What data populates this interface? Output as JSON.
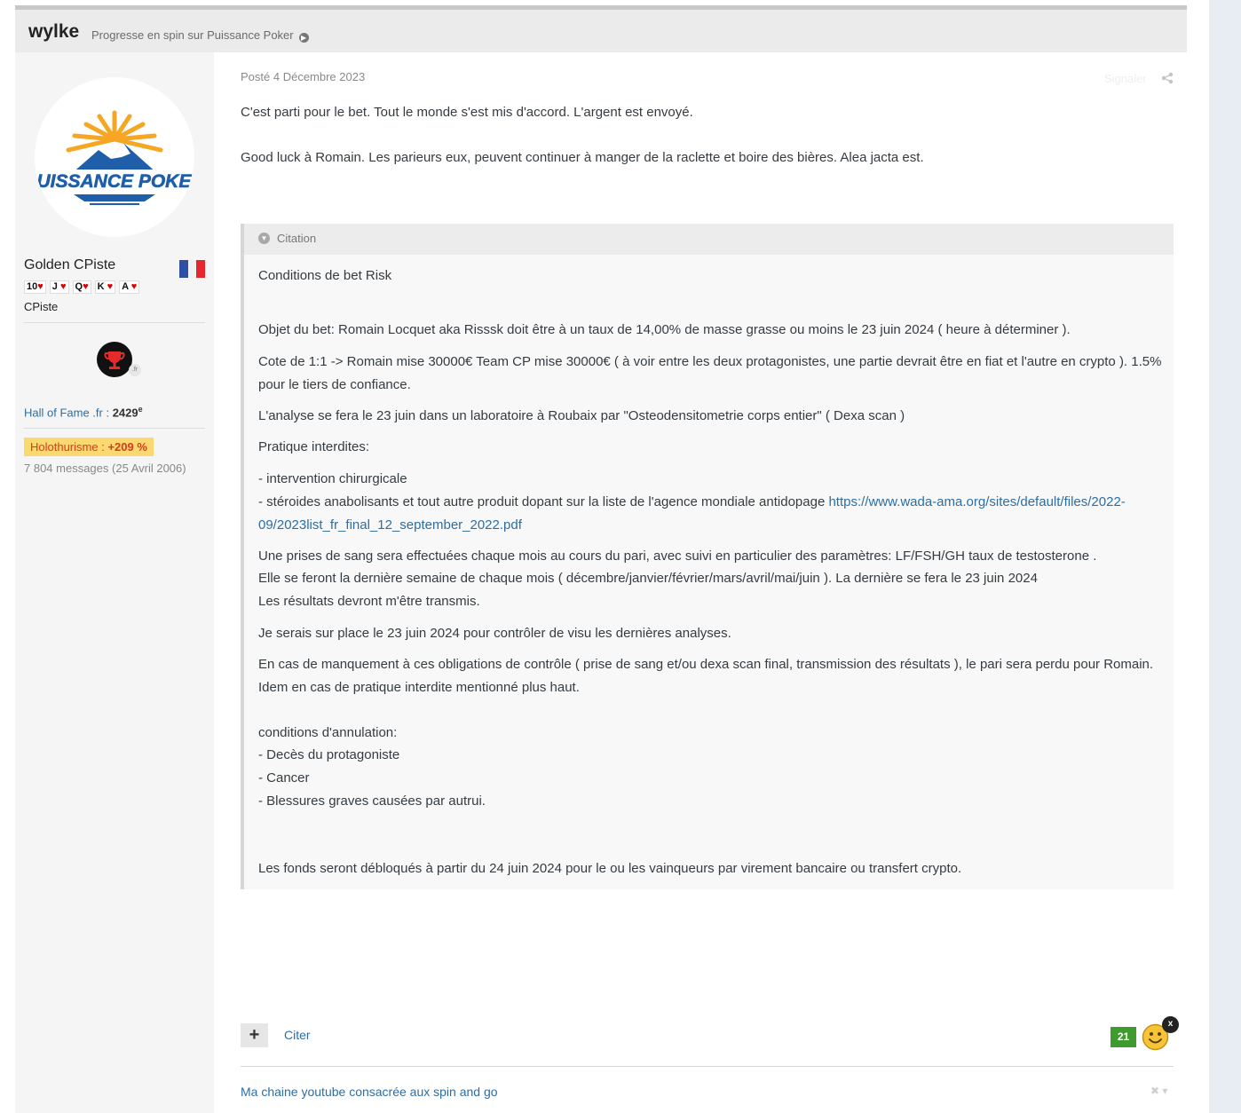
{
  "header": {
    "author": "wylke",
    "thread_title": "Progresse en spin sur Puissance Poker"
  },
  "author_panel": {
    "avatar_text": "PUISSANCE POKER",
    "title": "Golden CPiste",
    "cards": [
      "10",
      "J",
      "Q",
      "K",
      "A"
    ],
    "rank": "CPiste",
    "trophy_badge": ".fr",
    "hof_label": "Hall of Fame .fr :",
    "hof_value": "2429",
    "hof_suffix": "e",
    "holo_label": "Holothurisme :",
    "holo_value": "+209 %",
    "messages": "7 804 messages (25 Avril 2006)"
  },
  "post": {
    "date": "Posté 4 Décembre 2023",
    "report_label": "Signaler",
    "paragraph_1": "C'est parti pour le bet. Tout le monde s'est mis d'accord. L'argent est envoyé.",
    "paragraph_2": "Good luck à Romain. Les parieurs eux, peuvent continuer à manger de la raclette et boire des bières. Alea jacta est."
  },
  "quote": {
    "label": "Citation",
    "title": "Conditions de bet Risk",
    "objet": "Objet du bet: Romain Locquet aka Risssk doit être à un taux de 14,00% de masse grasse ou moins le 23 juin 2024 ( heure à déterminer ).",
    "cote": "Cote de 1:1  ->  Romain mise 30000€ Team CP mise 30000€ ( à voir entre les deux protagonistes, une partie devrait être en fiat et l'autre en crypto ). 1.5% pour le tiers de confiance.",
    "analyse": "L'analyse se fera le 23 juin dans un laboratoire à Roubaix par \"Osteodensitometrie corps entier\" ( Dexa scan )",
    "pratique_title": "Pratique interdites:",
    "pratique_1": "- intervention chirurgicale",
    "pratique_2": "- stéroides anabolisants et tout autre produit dopant sur la liste de l'agence mondiale antidopage ",
    "pratique_link": "https://www.wada-ama.org/sites/default/files/2022-09/2023list_fr_final_12_september_2022.pdf",
    "sang_1": "Une prises de sang sera effectuées chaque mois au cours du pari, avec suivi en particulier des paramètres: LF/FSH/GH taux de testosterone .",
    "sang_2": "Elle se feront la dernière semaine de chaque mois ( décembre/janvier/février/mars/avril/mai/juin ). La dernière se fera le 23 juin 2024",
    "sang_3": "Les résultats devront m'être transmis.",
    "sur_place": "Je serais sur place le 23 juin 2024 pour contrôler de visu les dernières analyses.",
    "manquement": "En cas de manquement à ces obligations de contrôle ( prise de sang et/ou dexa scan final, transmission des résultats ), le pari sera perdu pour Romain. Idem en cas de pratique interdite mentionné plus haut.",
    "annulation_title": "conditions d'annulation:",
    "annulation_1": "- Decès du protagoniste",
    "annulation_2": "- Cancer",
    "annulation_3": "- Blessures graves causées par autrui.",
    "fonds": "Les fonds seront débloqués à partir du 24 juin 2024 pour le ou les vainqueurs par virement bancaire ou transfert crypto."
  },
  "actions": {
    "plus": "+",
    "quote_button": "Citer",
    "reaction_count": "21",
    "reaction_close": "x"
  },
  "signature": {
    "text": "Ma chaine youtube consacrée aux spin and go"
  },
  "colors": {
    "link": "#2c6ea4",
    "reaction_green": "#3f9b2e",
    "holo_bg": "#fbd870"
  }
}
